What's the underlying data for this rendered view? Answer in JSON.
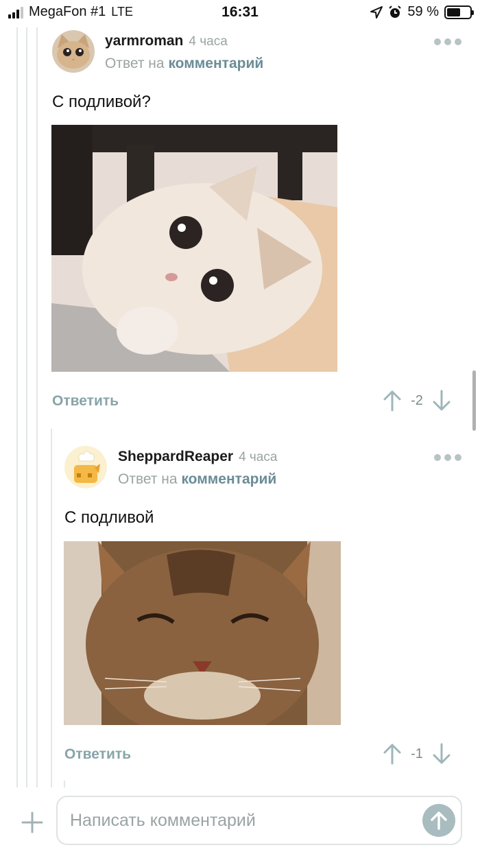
{
  "status_bar": {
    "carrier": "MegaFon #1",
    "network": "LTE",
    "time": "16:31",
    "battery": "59 %",
    "battery_level": 0.59
  },
  "comments": [
    {
      "author": "yarmroman",
      "time": "4 часа",
      "reply_prefix": "Ответ на",
      "reply_link": "комментарий",
      "text": "С подливой?",
      "image": "wide-eyed-cat-photo",
      "reply_label": "Ответить",
      "score": "-2"
    },
    {
      "author": "SheppardReaper",
      "time": "4 часа",
      "reply_prefix": "Ответ на",
      "reply_link": "комментарий",
      "text": "С подливой",
      "image": "smiling-tabby-cat-photo",
      "reply_label": "Ответить",
      "score": "-1"
    }
  ],
  "composer": {
    "placeholder": "Написать комментарий"
  },
  "colors": {
    "accent": "#6a8c96",
    "muted": "#9aa3a3",
    "send_button": "#a9bcbf",
    "thread_line": "#e3e6e6"
  }
}
